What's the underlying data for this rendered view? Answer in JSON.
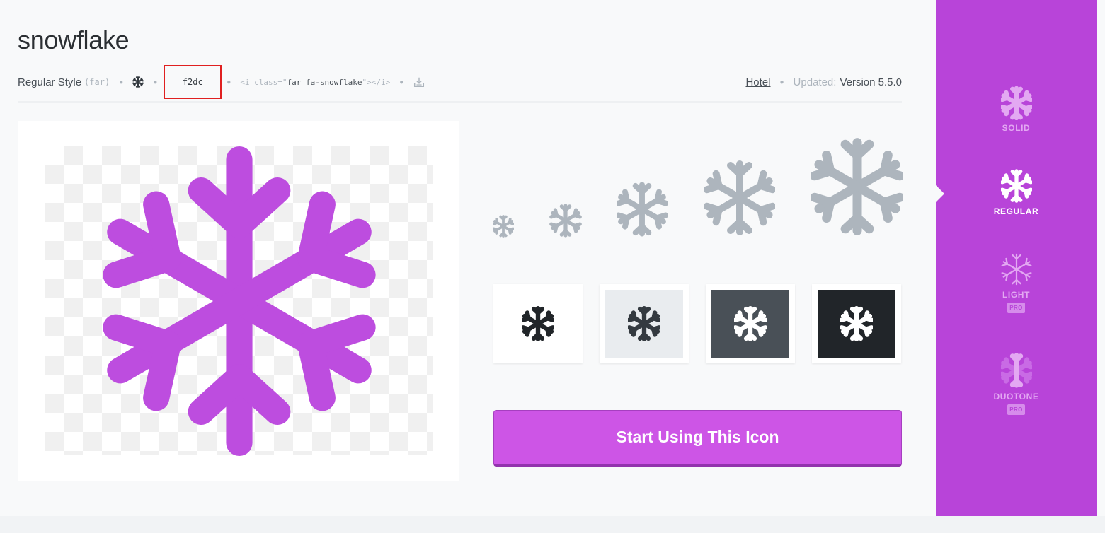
{
  "icon": {
    "name": "snowflake",
    "unicode": "f2dc"
  },
  "meta": {
    "style_name": "Regular Style",
    "style_prefix": "(far)",
    "html_snippet_open": "<i class=\"",
    "html_snippet_class": "far fa-snowflake",
    "html_snippet_close": "\"></i>",
    "category": "Hotel",
    "updated_label": "Updated:",
    "version": "Version 5.5.0"
  },
  "colors": {
    "brand": "#b844d9",
    "preview_icon": "#bd4ddf",
    "size_icon": "#adb5bd",
    "cta": "#cd55e6"
  },
  "swatches": [
    {
      "bg": "#ffffff",
      "fg": "#212529"
    },
    {
      "bg": "#e9ecef",
      "fg": "#343a40"
    },
    {
      "bg": "#495057",
      "fg": "#ffffff"
    },
    {
      "bg": "#212529",
      "fg": "#ffffff"
    }
  ],
  "cta_label": "Start Using This Icon",
  "sidebar": {
    "styles": [
      {
        "label": "SOLID",
        "active": false,
        "pro": ""
      },
      {
        "label": "REGULAR",
        "active": true,
        "pro": ""
      },
      {
        "label": "LIGHT",
        "active": false,
        "pro": "PRO"
      },
      {
        "label": "DUOTONE",
        "active": false,
        "pro": "PRO"
      }
    ]
  }
}
